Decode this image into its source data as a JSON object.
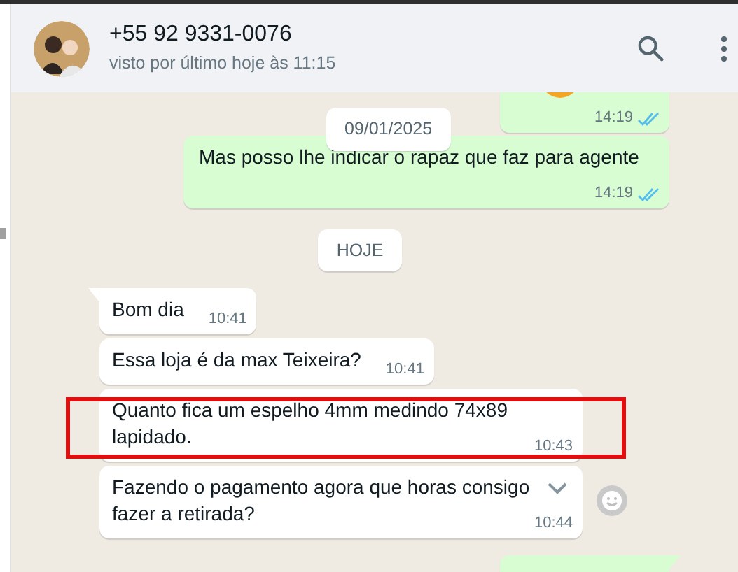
{
  "contact": {
    "name": "+55 92 9331-0076",
    "status": "visto por último hoje às 11:15"
  },
  "sticky_date": "09/01/2025",
  "messages": [
    {
      "kind": "sticker",
      "time": "14:19",
      "read": true,
      "tail": false
    },
    {
      "kind": "out",
      "text": "Mas posso lhe indicar o rapaz que faz para agente",
      "time": "14:19",
      "read": true,
      "tail": false
    },
    {
      "kind": "date",
      "text": "HOJE"
    },
    {
      "kind": "in",
      "text": "Bom dia",
      "time": "10:41",
      "tail": true
    },
    {
      "kind": "in",
      "text": "Essa loja é da max Teixeira?",
      "time": "10:41",
      "tail": false
    },
    {
      "kind": "in",
      "text": "Quanto fica um espelho 4mm medindo 74x89 lapidado.",
      "time": "10:43",
      "tail": false,
      "highlighted": true
    },
    {
      "kind": "in",
      "text": "Fazendo o pagamento agora que horas consigo fazer a retirada?",
      "time": "10:44",
      "tail": false,
      "hovered": true
    },
    {
      "kind": "out",
      "tail": true
    }
  ]
}
